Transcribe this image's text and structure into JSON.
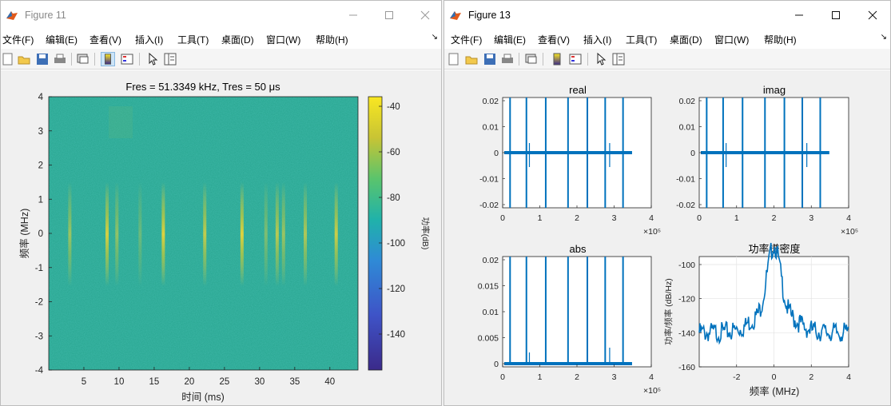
{
  "window1": {
    "title": "Figure 11",
    "menu": [
      "文件(F)",
      "编辑(E)",
      "查看(V)",
      "插入(I)",
      "工具(T)",
      "桌面(D)",
      "窗口(W)",
      "帮助(H)"
    ],
    "spectrogram": {
      "title": "Fres = 51.3349 kHz, Tres = 50 μs",
      "xlabel": "时间 (ms)",
      "ylabel": "频率 (MHz)",
      "xticks": [
        "5",
        "10",
        "15",
        "20",
        "25",
        "30",
        "35",
        "40"
      ],
      "yticks": [
        "4",
        "3",
        "2",
        "1",
        "0",
        "-1",
        "-2",
        "-3",
        "-4"
      ],
      "colorbar_label": "功率(dB)",
      "colorbar_ticks": [
        "-40",
        "-60",
        "-80",
        "-100",
        "-120",
        "-140"
      ],
      "colors": {
        "background": "#27a58f",
        "burst": "#e7d33a",
        "low": "#3b2a8a",
        "high": "#f9e721"
      }
    }
  },
  "window2": {
    "title": "Figure 13",
    "menu": [
      "文件(F)",
      "编辑(E)",
      "查看(V)",
      "插入(I)",
      "工具(T)",
      "桌面(D)",
      "窗口(W)",
      "帮助(H)"
    ],
    "subplots": {
      "real": {
        "title": "real",
        "yticks": [
          "0.02",
          "0.01",
          "0",
          "-0.01",
          "-0.02"
        ],
        "xticks": [
          "0",
          "1",
          "2",
          "3",
          "4"
        ],
        "exponent": "×10⁵"
      },
      "imag": {
        "title": "imag",
        "yticks": [
          "0.02",
          "0.01",
          "0",
          "-0.01",
          "-0.02"
        ],
        "xticks": [
          "0",
          "1",
          "2",
          "3",
          "4"
        ],
        "exponent": "×10⁵"
      },
      "abs": {
        "title": "abs",
        "yticks": [
          "0.02",
          "0.015",
          "0.01",
          "0.005",
          "0"
        ],
        "xticks": [
          "0",
          "1",
          "2",
          "3",
          "4"
        ],
        "exponent": "×10⁵"
      },
      "psd": {
        "title": "功率谱密度",
        "yticks": [
          "-100",
          "-120",
          "-140",
          "-160"
        ],
        "xticks": [
          "-2",
          "0",
          "2",
          "4"
        ],
        "xlabel": "频率 (MHz)",
        "ylabel": "功率/频率 (dB/Hz)"
      }
    },
    "line_color": "#0072bd"
  }
}
